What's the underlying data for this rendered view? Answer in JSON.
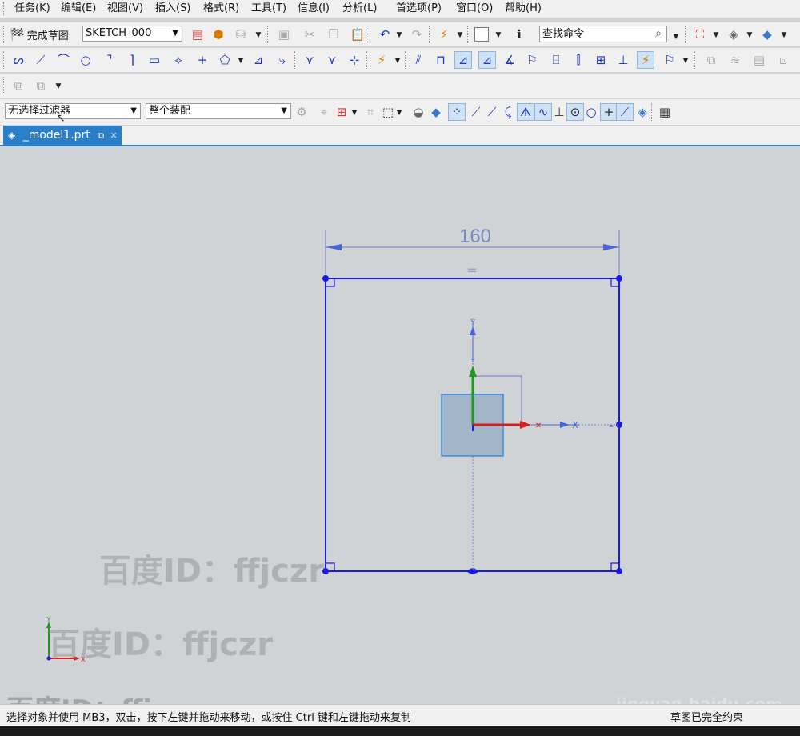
{
  "menu": [
    "任务(K)",
    "编辑(E)",
    "视图(V)",
    "插入(S)",
    "格式(R)",
    "工具(T)",
    "信息(I)",
    "分析(L)",
    "首选项(P)",
    "窗口(O)",
    "帮助(H)"
  ],
  "toolbar": {
    "finish_sketch_label": "完成草图",
    "sketch_name": "SKETCH_000",
    "find_command_placeholder": "查找命令"
  },
  "filters": {
    "selection_filter": "无选择过滤器",
    "assembly_scope": "整个装配"
  },
  "tab": {
    "title": "_model1.prt"
  },
  "sketch": {
    "dimension_value": "160",
    "equal_constraint": "=",
    "axis_y_label": "Y",
    "axis_x_label": "X",
    "triad_y_label": "Y",
    "triad_x_label": "X"
  },
  "watermarks": [
    "百度ID：ffjczr",
    "百度ID：ffjczr",
    "百度ID：ffjczr",
    "jingyan.baidu.com"
  ],
  "status": {
    "message": "选择对象并使用 MB3，双击，按下左键并拖动来移动，或按住 Ctrl 键和左键拖动来复制",
    "right": "草图已完全约束"
  },
  "colors": {
    "sketch_blue": "#1a1ae0",
    "dimension_blue": "#6a7ec0",
    "csys_green": "#1f9a1f",
    "csys_red": "#d62020",
    "tab_blue": "#2b7fc8",
    "canvas_bg": "#d0d3d6"
  }
}
